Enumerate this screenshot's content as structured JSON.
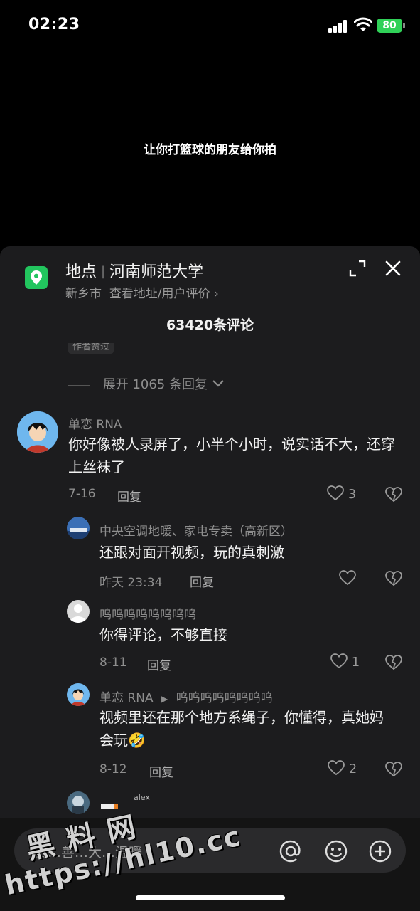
{
  "status": {
    "time": "02:23",
    "battery": "80"
  },
  "video": {
    "caption": "让你打篮球的朋友给你拍"
  },
  "location": {
    "label": "地点",
    "name": "河南师范大学",
    "city": "新乡市",
    "link": "查看地址/用户评价",
    "icon": "map-pin-icon"
  },
  "comments_header": {
    "count": "63420条评论"
  },
  "partial_badge": "作者赞过",
  "expand": {
    "label": "展开 1065 条回复"
  },
  "comments": [
    {
      "name": "单恋 RNA",
      "text": "你好像被人录屏了，小半个小时，说实话不大，还穿上丝袜了",
      "date": "7-16",
      "reply": "回复",
      "likes": "3"
    }
  ],
  "replies": [
    {
      "name": "中央空调地暖、家电专卖（高新区）",
      "text": "还跟对面开视频，玩的真刺激",
      "date": "昨天 23:34",
      "reply": "回复",
      "likes": ""
    },
    {
      "name": "呜呜呜呜呜呜呜呜",
      "text": "你得评论，不够直接",
      "date": "8-11",
      "reply": "回复",
      "likes": "1"
    },
    {
      "name": "单恋 RNA",
      "reply_to": "呜呜呜呜呜呜呜呜",
      "text": "视频里还在那个地方系绳子，你懂得，真她妈会玩🤣",
      "date": "8-12",
      "reply": "回复",
      "likes": "2"
    }
  ],
  "partial_reply": {
    "name_tag": "alex"
  },
  "input": {
    "placeholder": "有爱评论，说点好听的~",
    "visible_placeholder": "白…善…大…温暖"
  },
  "watermark": {
    "line1": "黑 料 网",
    "line2": "https://hl10.cc"
  },
  "colors": {
    "background": "#000000",
    "sheet": "#1c1c1e",
    "location_icon": "#22c55e",
    "battery": "#30d158"
  }
}
